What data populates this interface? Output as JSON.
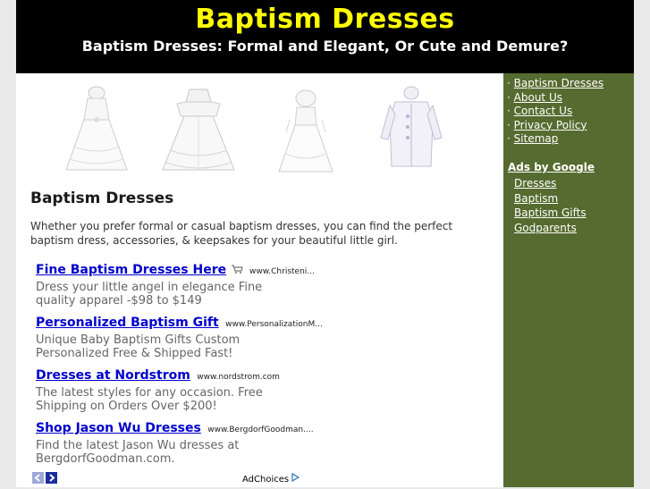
{
  "header": {
    "title": "Baptism Dresses",
    "subtitle": "Baptism Dresses: Formal and Elegant, Or Cute and Demure?"
  },
  "main": {
    "heading": "Baptism Dresses",
    "intro": "Whether you prefer formal or casual baptism dresses, you can find the perfect baptism dress, accessories, & keepsakes for your beautiful little girl."
  },
  "ads": [
    {
      "title": "Fine Baptism Dresses Here",
      "url": "www.Christeni...",
      "desc": "Dress your little angel in elegance Fine quality apparel -$98 to $149"
    },
    {
      "title": "Personalized Baptism Gift",
      "url": "www.PersonalizationM...",
      "desc": "Unique Baby Baptism Gifts Custom Personalized Free & Shipped Fast!"
    },
    {
      "title": "Dresses at Nordstrom",
      "url": "www.nordstrom.com",
      "desc": "The latest styles for any occasion. Free Shipping on Orders Over $200!"
    },
    {
      "title": "Shop Jason Wu Dresses",
      "url": "www.BergdorfGoodman....",
      "desc": "Find the latest Jason Wu dresses at BergdorfGoodman.com."
    }
  ],
  "adchoices": "AdChoices",
  "sidebar": {
    "nav": [
      "Baptism Dresses",
      "About Us",
      "Contact Us",
      "Privacy Policy",
      "Sitemap"
    ],
    "bullet": "·",
    "ads_label": "Ads by Google",
    "ad_links": [
      "Dresses",
      "Baptism",
      "Baptism Gifts",
      "Godparents"
    ]
  },
  "colors": {
    "header_bg": "#000000",
    "title": "#ffff00",
    "sidebar_bg": "#556b2f",
    "ad_link": "#0000cc"
  }
}
